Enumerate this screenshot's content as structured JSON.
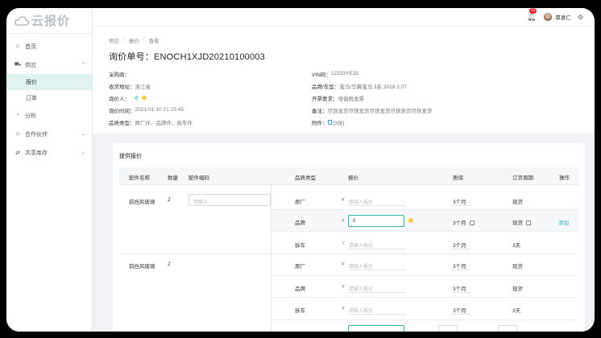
{
  "app": {
    "logo_text": "云报价"
  },
  "sidebar": {
    "items": [
      {
        "label": "首页",
        "icon": "home-icon"
      },
      {
        "label": "供应",
        "icon": "cart-icon"
      },
      {
        "label": "分析",
        "icon": "chart-icon"
      },
      {
        "label": "合作伙伴",
        "icon": "partner-icon"
      },
      {
        "label": "共享库存",
        "icon": "shared-stock-icon"
      }
    ],
    "sub_items": [
      {
        "label": "报价",
        "active": true
      },
      {
        "label": "订单",
        "active": false
      }
    ]
  },
  "topbar": {
    "notification_count": "12",
    "user_name": "覃喜仁"
  },
  "breadcrumb": [
    "供应",
    "报价",
    "查看"
  ],
  "page": {
    "title": "询价单号：ENOCH1XJD20210100003"
  },
  "fields": {
    "purchaser_label": "采购商：",
    "purchaser_value": "",
    "vin_label": "VIN码：",
    "vin_value": "12333YE33",
    "address_label": "收货地址：",
    "address_value": "浙江省",
    "model_label": "品牌/车型：",
    "model_value": "宝马/华晨宝马 3系 2018 2.0T",
    "inquirer_label": "询价人：",
    "inquirer_value": "",
    "invoice_label": "开票要求：",
    "invoice_value": "增值税发票",
    "time_label": "询价时间：",
    "time_value": "2021-01-10 21:23:45",
    "remark_label": "备注：",
    "remark_value": "尽快发货尽快发货尽快发货尽快发货尽快发货",
    "quality_label": "品质类型：",
    "quality_value": "原厂件、品牌件、拆车件",
    "attach_label": "附件：",
    "attach_value": "[3张]"
  },
  "quote": {
    "title": "提供报价",
    "columns": [
      "配件名称",
      "数量",
      "配件编码",
      "品质类型",
      "报价",
      "质保",
      "订货周期",
      "操作"
    ],
    "groups": [
      {
        "part": "前挡风玻璃",
        "qty": "2",
        "code_placeholder": "请输入",
        "rows": [
          {
            "quality": "原厂",
            "currency": "¥",
            "price": "",
            "price_placeholder": "请输入报价",
            "warranty": "3个月",
            "cycle": "现货",
            "action": ""
          },
          {
            "quality": "品牌",
            "currency": "¥",
            "price": "0",
            "price_placeholder": "",
            "warranty": "3个月",
            "cycle": "现货",
            "action": "添加"
          },
          {
            "quality": "拆车",
            "currency": "Y",
            "price": "",
            "price_placeholder": "请输入报价",
            "warranty": "3个月",
            "cycle": "3天",
            "action": ""
          }
        ]
      },
      {
        "part": "前挡风玻璃",
        "qty": "2",
        "rows": [
          {
            "quality": "原厂",
            "currency": "¥",
            "price": "",
            "price_placeholder": "请输入报价",
            "warranty": "3个月",
            "cycle": "现货"
          },
          {
            "quality": "品牌",
            "currency": "¥",
            "price": "",
            "price_placeholder": "请输入报价",
            "warranty": "3个月",
            "cycle": "现货"
          },
          {
            "quality": "拆车",
            "currency": "¥",
            "price": "",
            "price_placeholder": "请输入报价",
            "warranty": "3个月",
            "cycle": "3天"
          }
        ]
      }
    ]
  },
  "colors": {
    "accent": "#2fb5a9",
    "active_bg": "#dff4f2",
    "badge": "#f5222d"
  }
}
